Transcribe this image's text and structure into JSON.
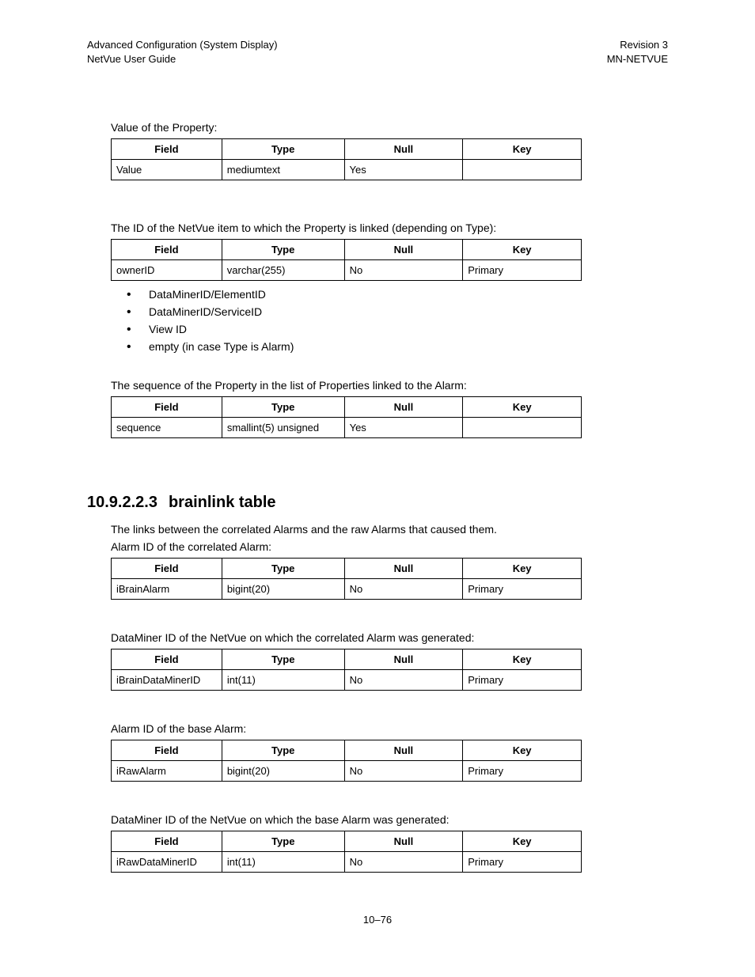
{
  "header": {
    "left1": "Advanced Configuration (System Display)",
    "left2": "NetVue User Guide",
    "right1": "Revision 3",
    "right2": "MN-NETVUE"
  },
  "table_headers": {
    "field": "Field",
    "type": "Type",
    "null": "Null",
    "key": "Key"
  },
  "blocks": {
    "valueProp": {
      "caption": "Value of the Property:",
      "row": {
        "field": "Value",
        "type": "mediumtext",
        "nul": "Yes",
        "key": ""
      }
    },
    "ownerID": {
      "caption": "The ID of the NetVue item to which the Property is linked (depending on Type):",
      "row": {
        "field": "ownerID",
        "type": "varchar(255)",
        "nul": "No",
        "key": "Primary"
      },
      "bullets": [
        "DataMinerID/ElementID",
        "DataMinerID/ServiceID",
        "View ID",
        "empty (in case Type is Alarm)"
      ]
    },
    "sequence": {
      "caption": "The sequence of the Property in the list of Properties linked to the Alarm:",
      "row": {
        "field": "sequence",
        "type": "smallint(5) unsigned",
        "nul": "Yes",
        "key": ""
      }
    }
  },
  "section": {
    "number": "10.9.2.2.3",
    "title": "brainlink table",
    "intro1": "The links between the correlated Alarms and the raw Alarms that caused them.",
    "intro2": "Alarm ID of the correlated Alarm:",
    "iBrainAlarm": {
      "field": "iBrainAlarm",
      "type": "bigint(20)",
      "nul": "No",
      "key": "Primary"
    },
    "cap2": "DataMiner ID of the NetVue on which the correlated Alarm was generated:",
    "iBrainDataMinerID": {
      "field": "iBrainDataMinerID",
      "type": "int(11)",
      "nul": "No",
      "key": "Primary"
    },
    "cap3": "Alarm ID of the base Alarm:",
    "iRawAlarm": {
      "field": "iRawAlarm",
      "type": "bigint(20)",
      "nul": "No",
      "key": "Primary"
    },
    "cap4": "DataMiner ID of the NetVue on which the base Alarm was generated:",
    "iRawDataMinerID": {
      "field": "iRawDataMinerID",
      "type": "int(11)",
      "nul": "No",
      "key": "Primary"
    }
  },
  "footer": "10–76"
}
